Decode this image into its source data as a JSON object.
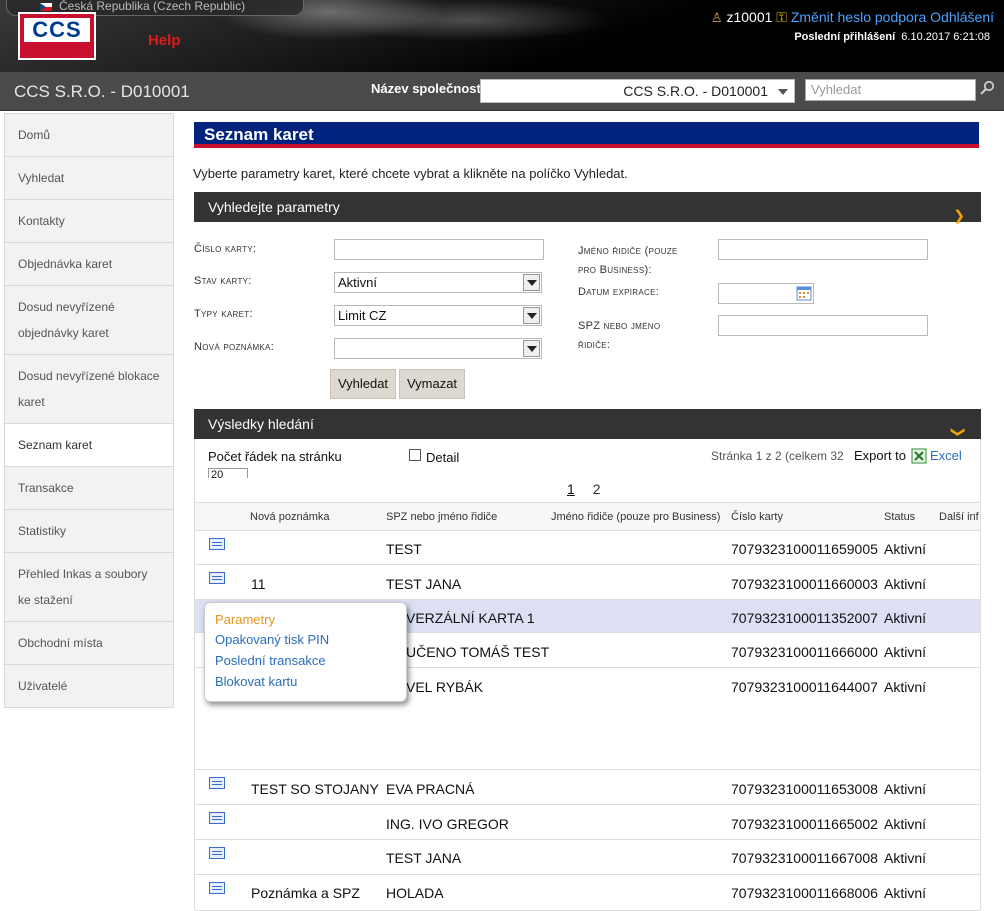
{
  "header": {
    "language": "Česká Republika (Czech Republic)",
    "logo_text": "CCS",
    "help_label": "Help",
    "username": "z10001",
    "change_password_label": "Změnit heslo",
    "support_label": "podpora",
    "logout_label": "Odhlášení",
    "last_login_label": "Poslední přihlášení",
    "last_login_value": "6.10.2017 6:21:08"
  },
  "company_bar": {
    "company_name": "CCS S.R.O. - D010001",
    "company_label": "Název společnosti",
    "company_selected": "CCS S.R.O. - D010001",
    "search_placeholder": "Vyhledat"
  },
  "sidebar": {
    "items": [
      {
        "label": "Domů"
      },
      {
        "label": "Vyhledat"
      },
      {
        "label": "Kontakty"
      },
      {
        "label": "Objednávka karet"
      },
      {
        "label": "Dosud nevyřízené objednávky karet"
      },
      {
        "label": "Dosud nevyřízené blokace karet"
      },
      {
        "label": "Seznam karet"
      },
      {
        "label": "Transakce"
      },
      {
        "label": "Statistiky"
      },
      {
        "label": "Přehled Inkas a soubory ke stažení"
      },
      {
        "label": "Obchodní místa"
      },
      {
        "label": "Uživatelé"
      }
    ],
    "active": "Seznam karet"
  },
  "page": {
    "title": "Seznam karet",
    "intro": "Vyberte parametry karet, které chcete vybrat a klikněte na políčko Vyhledat."
  },
  "search_params": {
    "header": "Vyhledejte parametry",
    "card_number_label": "Číslo karty:",
    "card_status_label": "Stav karty:",
    "card_status_value": "Aktivní",
    "card_types_label": "Typy karet:",
    "card_types_value": "Limit CZ",
    "new_note_label": "Nová poznámka:",
    "new_note_value": "",
    "driver_name_label_1": "Jméno řidiče (pouze",
    "driver_name_label_2": "pro Business):",
    "expiry_label": "Datum expirace:",
    "plate_label_1": "SPZ nebo jméno",
    "plate_label_2": "řidiče:",
    "search_button": "Vyhledat",
    "clear_button": "Vymazat"
  },
  "results": {
    "header": "Výsledky hledání",
    "rows_per_page_label": "Počet řádek na stránku",
    "rows_per_page_value": "20",
    "detail_label": "Detail",
    "page_info": "Stránka 1 z 2 (celkem 32",
    "export_label": "Export to",
    "excel_label": "Excel",
    "pages": [
      "1",
      "2"
    ],
    "columns": [
      "Nová poznámka",
      "SPZ nebo jméno řidiče",
      "Jméno řidiče (pouze pro Business)",
      "Číslo karty",
      "Status",
      "Další inf"
    ],
    "rows": [
      {
        "note": "",
        "plate": "TEST",
        "driver": "",
        "card": "7079323100011659005",
        "status": "Aktivní"
      },
      {
        "note": "11",
        "plate": "TEST JANA",
        "driver": "",
        "card": "7079323100011660003",
        "status": "Aktivní"
      },
      {
        "note": "",
        "plate": "VERZÁLNÍ KARTA 1",
        "driver": "",
        "card": "7079323100011352007",
        "status": "Aktivní"
      },
      {
        "note": "",
        "plate": "UČENO TOMÁŠ TEST",
        "driver": "",
        "card": "7079323100011666000",
        "status": "Aktivní"
      },
      {
        "note": "",
        "plate": "VEL RYBÁK",
        "driver": "",
        "card": "7079323100011644007",
        "status": "Aktivní"
      },
      {
        "note": "TEST SO STOJANY",
        "plate": "EVA PRACNÁ",
        "driver": "",
        "card": "7079323100011653008",
        "status": "Aktivní"
      },
      {
        "note": "",
        "plate": "ING. IVO GREGOR",
        "driver": "",
        "card": "7079323100011665002",
        "status": "Aktivní"
      },
      {
        "note": "",
        "plate": "TEST JANA",
        "driver": "",
        "card": "7079323100011667008",
        "status": "Aktivní"
      },
      {
        "note": "Poznámka a SPZ",
        "plate": "HOLADA",
        "driver": "",
        "card": "7079323100011668006",
        "status": "Aktivní"
      }
    ]
  },
  "context_menu": {
    "items": [
      "Parametry",
      "Opakovaný tisk PIN",
      "Poslední transakce",
      "Blokovat kartu"
    ]
  },
  "colors": {
    "title_bar": "#00247d",
    "title_underline": "#c8102e",
    "dark_bar": "#333333",
    "accent_chevron": "#f0a500",
    "link": "#2a6ebb",
    "highlight_row": "#dde0f5"
  }
}
